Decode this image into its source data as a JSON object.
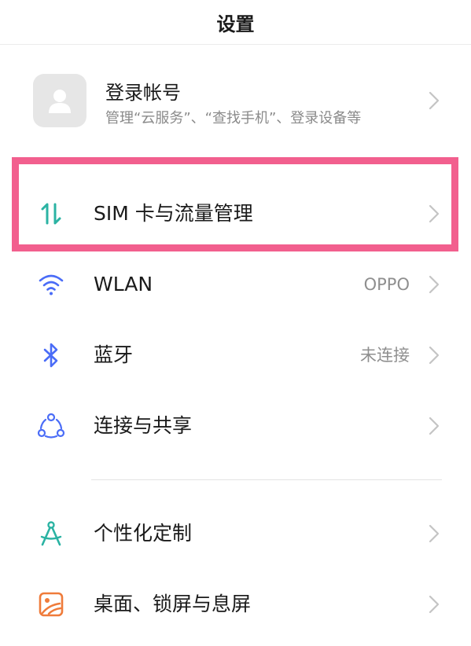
{
  "header": {
    "title": "设置"
  },
  "account": {
    "title": "登录帐号",
    "subtitle": "管理“云服务”、“查找手机”、登录设备等"
  },
  "items": [
    {
      "label": "SIM 卡与流量管理",
      "value": "",
      "icon": "sim-data-icon"
    },
    {
      "label": "WLAN",
      "value": "OPPO",
      "icon": "wifi-icon"
    },
    {
      "label": "蓝牙",
      "value": "未连接",
      "icon": "bluetooth-icon"
    },
    {
      "label": "连接与共享",
      "value": "",
      "icon": "connection-share-icon"
    },
    {
      "label": "个性化定制",
      "value": "",
      "icon": "personalization-icon"
    },
    {
      "label": "桌面、锁屏与息屏",
      "value": "",
      "icon": "wallpaper-icon"
    }
  ],
  "colors": {
    "highlight": "#f25f8e",
    "teal": "#2bb3a3",
    "blue": "#4a6cf7",
    "orange": "#ef7b3a"
  }
}
